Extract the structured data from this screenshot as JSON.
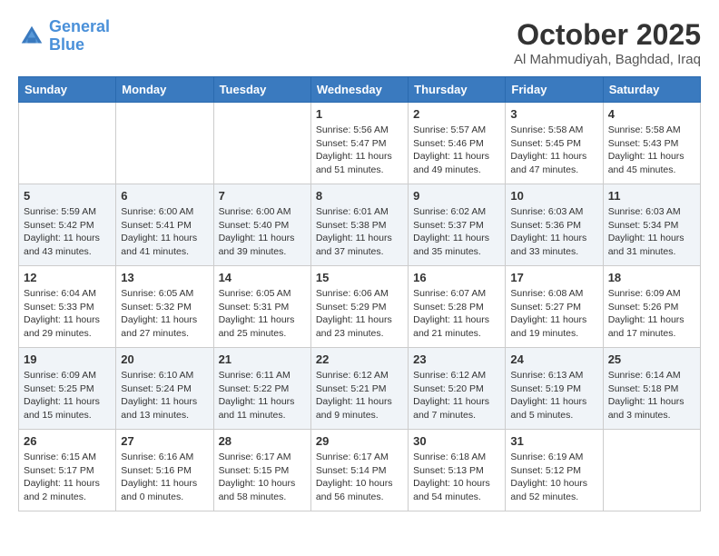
{
  "header": {
    "logo_line1": "General",
    "logo_line2": "Blue",
    "month": "October 2025",
    "location": "Al Mahmudiyah, Baghdad, Iraq"
  },
  "weekdays": [
    "Sunday",
    "Monday",
    "Tuesday",
    "Wednesday",
    "Thursday",
    "Friday",
    "Saturday"
  ],
  "weeks": [
    [
      {
        "day": "",
        "info": ""
      },
      {
        "day": "",
        "info": ""
      },
      {
        "day": "",
        "info": ""
      },
      {
        "day": "1",
        "info": "Sunrise: 5:56 AM\nSunset: 5:47 PM\nDaylight: 11 hours\nand 51 minutes."
      },
      {
        "day": "2",
        "info": "Sunrise: 5:57 AM\nSunset: 5:46 PM\nDaylight: 11 hours\nand 49 minutes."
      },
      {
        "day": "3",
        "info": "Sunrise: 5:58 AM\nSunset: 5:45 PM\nDaylight: 11 hours\nand 47 minutes."
      },
      {
        "day": "4",
        "info": "Sunrise: 5:58 AM\nSunset: 5:43 PM\nDaylight: 11 hours\nand 45 minutes."
      }
    ],
    [
      {
        "day": "5",
        "info": "Sunrise: 5:59 AM\nSunset: 5:42 PM\nDaylight: 11 hours\nand 43 minutes."
      },
      {
        "day": "6",
        "info": "Sunrise: 6:00 AM\nSunset: 5:41 PM\nDaylight: 11 hours\nand 41 minutes."
      },
      {
        "day": "7",
        "info": "Sunrise: 6:00 AM\nSunset: 5:40 PM\nDaylight: 11 hours\nand 39 minutes."
      },
      {
        "day": "8",
        "info": "Sunrise: 6:01 AM\nSunset: 5:38 PM\nDaylight: 11 hours\nand 37 minutes."
      },
      {
        "day": "9",
        "info": "Sunrise: 6:02 AM\nSunset: 5:37 PM\nDaylight: 11 hours\nand 35 minutes."
      },
      {
        "day": "10",
        "info": "Sunrise: 6:03 AM\nSunset: 5:36 PM\nDaylight: 11 hours\nand 33 minutes."
      },
      {
        "day": "11",
        "info": "Sunrise: 6:03 AM\nSunset: 5:34 PM\nDaylight: 11 hours\nand 31 minutes."
      }
    ],
    [
      {
        "day": "12",
        "info": "Sunrise: 6:04 AM\nSunset: 5:33 PM\nDaylight: 11 hours\nand 29 minutes."
      },
      {
        "day": "13",
        "info": "Sunrise: 6:05 AM\nSunset: 5:32 PM\nDaylight: 11 hours\nand 27 minutes."
      },
      {
        "day": "14",
        "info": "Sunrise: 6:05 AM\nSunset: 5:31 PM\nDaylight: 11 hours\nand 25 minutes."
      },
      {
        "day": "15",
        "info": "Sunrise: 6:06 AM\nSunset: 5:29 PM\nDaylight: 11 hours\nand 23 minutes."
      },
      {
        "day": "16",
        "info": "Sunrise: 6:07 AM\nSunset: 5:28 PM\nDaylight: 11 hours\nand 21 minutes."
      },
      {
        "day": "17",
        "info": "Sunrise: 6:08 AM\nSunset: 5:27 PM\nDaylight: 11 hours\nand 19 minutes."
      },
      {
        "day": "18",
        "info": "Sunrise: 6:09 AM\nSunset: 5:26 PM\nDaylight: 11 hours\nand 17 minutes."
      }
    ],
    [
      {
        "day": "19",
        "info": "Sunrise: 6:09 AM\nSunset: 5:25 PM\nDaylight: 11 hours\nand 15 minutes."
      },
      {
        "day": "20",
        "info": "Sunrise: 6:10 AM\nSunset: 5:24 PM\nDaylight: 11 hours\nand 13 minutes."
      },
      {
        "day": "21",
        "info": "Sunrise: 6:11 AM\nSunset: 5:22 PM\nDaylight: 11 hours\nand 11 minutes."
      },
      {
        "day": "22",
        "info": "Sunrise: 6:12 AM\nSunset: 5:21 PM\nDaylight: 11 hours\nand 9 minutes."
      },
      {
        "day": "23",
        "info": "Sunrise: 6:12 AM\nSunset: 5:20 PM\nDaylight: 11 hours\nand 7 minutes."
      },
      {
        "day": "24",
        "info": "Sunrise: 6:13 AM\nSunset: 5:19 PM\nDaylight: 11 hours\nand 5 minutes."
      },
      {
        "day": "25",
        "info": "Sunrise: 6:14 AM\nSunset: 5:18 PM\nDaylight: 11 hours\nand 3 minutes."
      }
    ],
    [
      {
        "day": "26",
        "info": "Sunrise: 6:15 AM\nSunset: 5:17 PM\nDaylight: 11 hours\nand 2 minutes."
      },
      {
        "day": "27",
        "info": "Sunrise: 6:16 AM\nSunset: 5:16 PM\nDaylight: 11 hours\nand 0 minutes."
      },
      {
        "day": "28",
        "info": "Sunrise: 6:17 AM\nSunset: 5:15 PM\nDaylight: 10 hours\nand 58 minutes."
      },
      {
        "day": "29",
        "info": "Sunrise: 6:17 AM\nSunset: 5:14 PM\nDaylight: 10 hours\nand 56 minutes."
      },
      {
        "day": "30",
        "info": "Sunrise: 6:18 AM\nSunset: 5:13 PM\nDaylight: 10 hours\nand 54 minutes."
      },
      {
        "day": "31",
        "info": "Sunrise: 6:19 AM\nSunset: 5:12 PM\nDaylight: 10 hours\nand 52 minutes."
      },
      {
        "day": "",
        "info": ""
      }
    ]
  ]
}
